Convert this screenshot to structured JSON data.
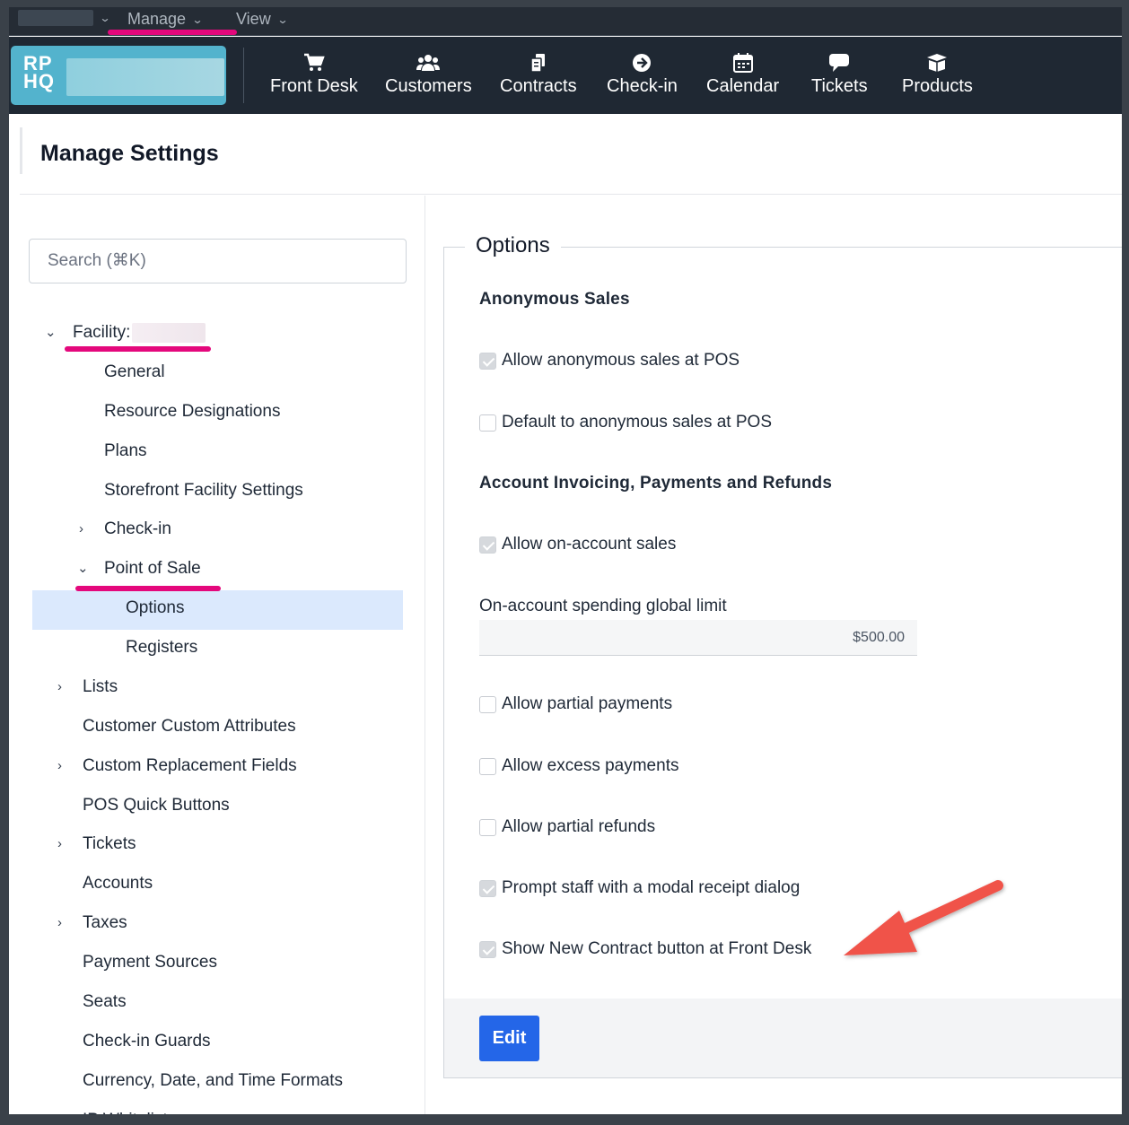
{
  "menubar": {
    "manage_label": "Manage",
    "view_label": "View"
  },
  "logo": {
    "text_line1": "RP",
    "text_line2": "HQ"
  },
  "nav": [
    {
      "label": "Front Desk",
      "icon": "cart-icon"
    },
    {
      "label": "Customers",
      "icon": "users-icon"
    },
    {
      "label": "Contracts",
      "icon": "documents-icon"
    },
    {
      "label": "Check-in",
      "icon": "arrow-circle-icon"
    },
    {
      "label": "Calendar",
      "icon": "calendar-icon"
    },
    {
      "label": "Tickets",
      "icon": "speech-bubble-icon"
    },
    {
      "label": "Products",
      "icon": "box-icon"
    }
  ],
  "page": {
    "title": "Manage Settings"
  },
  "sidebar": {
    "search_placeholder": "Search (⌘K)",
    "facility_label": "Facility:",
    "items": {
      "general": "General",
      "resource_designations": "Resource Designations",
      "plans": "Plans",
      "storefront": "Storefront Facility Settings",
      "checkin": "Check-in",
      "pos": "Point of Sale",
      "options": "Options",
      "registers": "Registers",
      "lists": "Lists",
      "customer_custom_attributes": "Customer Custom Attributes",
      "custom_replacement_fields": "Custom Replacement Fields",
      "pos_quick_buttons": "POS Quick Buttons",
      "tickets": "Tickets",
      "accounts": "Accounts",
      "taxes": "Taxes",
      "payment_sources": "Payment Sources",
      "seats": "Seats",
      "checkin_guards": "Check-in Guards",
      "formats": "Currency, Date, and Time Formats",
      "ip_whitelist": "IP Whitelist"
    }
  },
  "options": {
    "legend": "Options",
    "anonymous_title": "Anonymous Sales",
    "allow_anonymous": {
      "label": "Allow anonymous sales at POS",
      "checked": true
    },
    "default_anonymous": {
      "label": "Default to anonymous sales at POS",
      "checked": false
    },
    "account_title": "Account Invoicing, Payments and Refunds",
    "allow_on_account": {
      "label": "Allow on-account sales",
      "checked": true
    },
    "limit_label": "On-account spending global limit",
    "limit_value": "$500.00",
    "allow_partial_payments": {
      "label": "Allow partial payments",
      "checked": false
    },
    "allow_excess_payments": {
      "label": "Allow excess payments",
      "checked": false
    },
    "allow_partial_refunds": {
      "label": "Allow partial refunds",
      "checked": false
    },
    "prompt_receipt": {
      "label": "Prompt staff with a modal receipt dialog",
      "checked": true
    },
    "show_new_contract": {
      "label": "Show New Contract button at Front Desk",
      "checked": true
    },
    "edit_label": "Edit"
  },
  "colors": {
    "accent_pink": "#e4087c",
    "nav_bg": "#1f2833",
    "primary_button": "#2466e8",
    "selected_bg": "#dbe9fd",
    "annotation_arrow": "#f0524a"
  }
}
